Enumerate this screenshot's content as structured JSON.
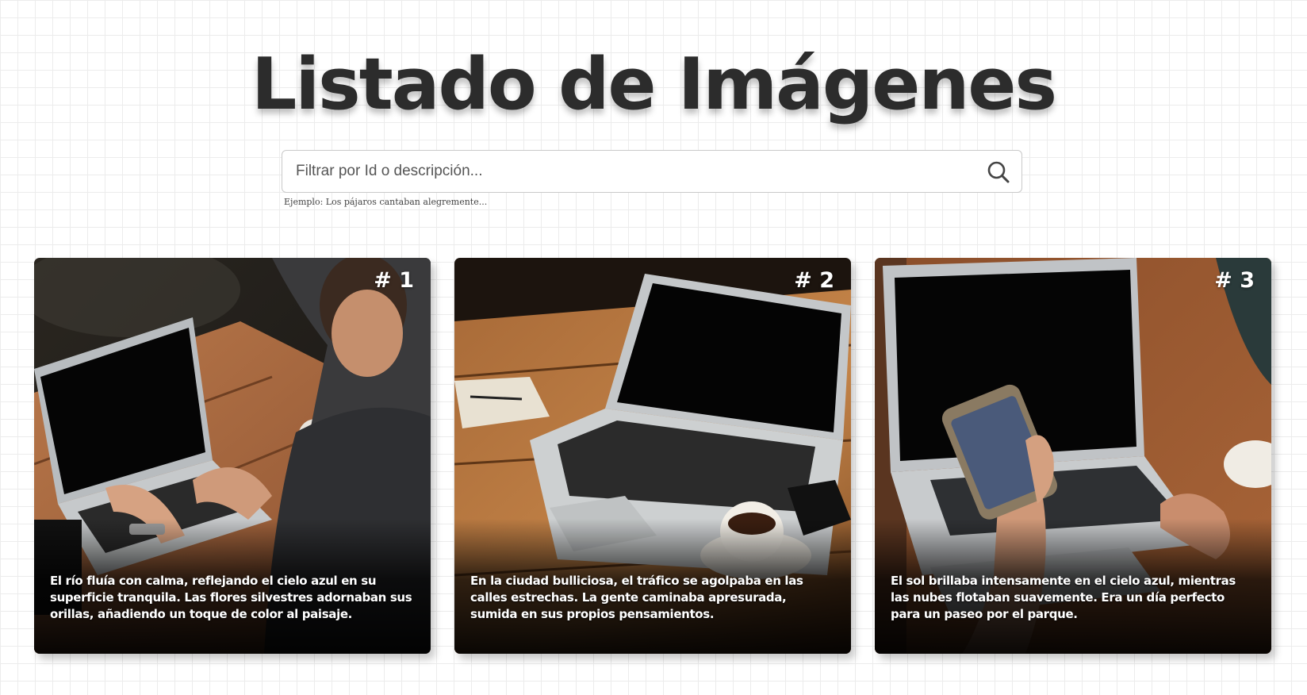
{
  "page": {
    "title": "Listado de Imágenes"
  },
  "search": {
    "placeholder": "Filtrar por Id o descripción...",
    "value": "",
    "hint": "Ejemplo: Los pájaros cantaban alegremente...",
    "icon": "search-icon"
  },
  "cards": [
    {
      "number": "# 1",
      "description": "El río fluía con calma, reflejando el cielo azul en su superficie tranquila. Las flores silvestres adornaban sus orillas, añadiendo un toque de color al paisaje."
    },
    {
      "number": "# 2",
      "description": "En la ciudad bulliciosa, el tráfico se agolpaba en las calles estrechas. La gente caminaba apresurada, sumida en sus propios pensamientos."
    },
    {
      "number": "# 3",
      "description": "El sol brillaba intensamente en el cielo azul, mientras las nubes flotaban suavemente. Era un día perfecto para un paseo por el parque."
    }
  ]
}
